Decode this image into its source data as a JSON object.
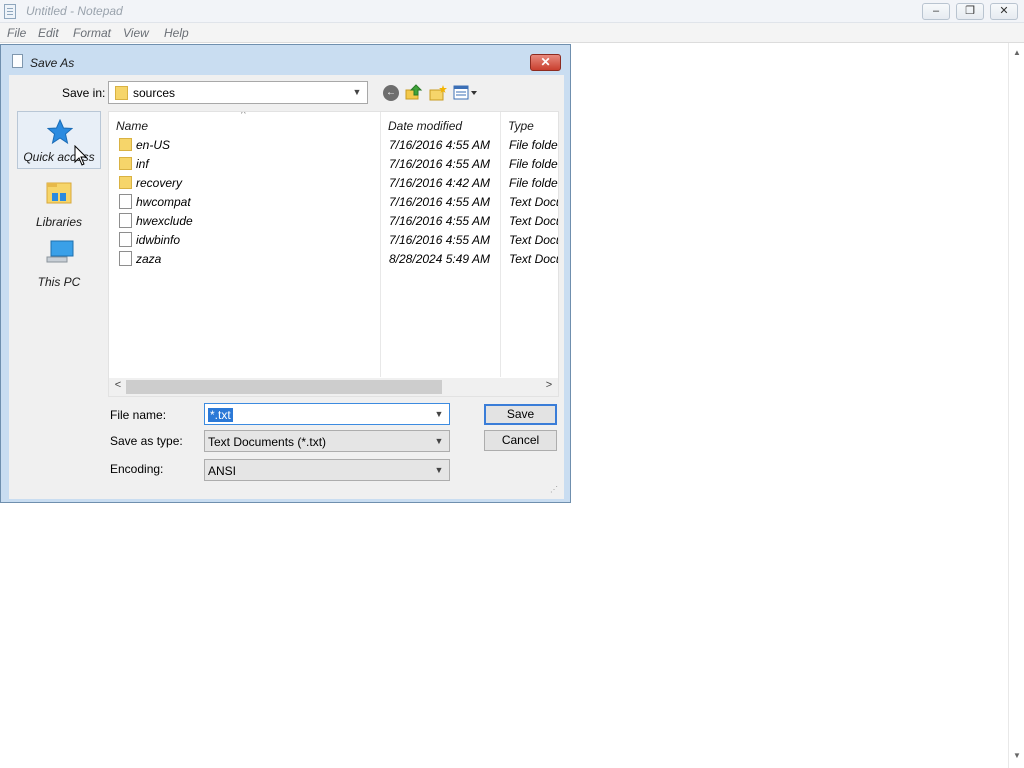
{
  "notepad": {
    "title": "Untitled - Notepad",
    "menu": [
      "File",
      "Edit",
      "Format",
      "View",
      "Help"
    ],
    "window_buttons": {
      "minimize": "–",
      "restore": "❐",
      "close": "✕"
    }
  },
  "dialog": {
    "title": "Save As",
    "close_glyph": "✕",
    "save_in_label": "Save in:",
    "save_in_value": "sources",
    "places": [
      {
        "label": "Quick access",
        "icon": "star-icon"
      },
      {
        "label": "Libraries",
        "icon": "libraries-icon"
      },
      {
        "label": "This PC",
        "icon": "computer-icon"
      }
    ],
    "columns": {
      "name": "Name",
      "date": "Date modified",
      "type": "Type"
    },
    "files": [
      {
        "name": "en-US",
        "date": "7/16/2016 4:55 AM",
        "type": "File folder",
        "kind": "folder"
      },
      {
        "name": "inf",
        "date": "7/16/2016 4:55 AM",
        "type": "File folder",
        "kind": "folder"
      },
      {
        "name": "recovery",
        "date": "7/16/2016 4:42 AM",
        "type": "File folder",
        "kind": "folder"
      },
      {
        "name": "hwcompat",
        "date": "7/16/2016 4:55 AM",
        "type": "Text Docu...",
        "kind": "file"
      },
      {
        "name": "hwexclude",
        "date": "7/16/2016 4:55 AM",
        "type": "Text Docu...",
        "kind": "file"
      },
      {
        "name": "idwbinfo",
        "date": "7/16/2016 4:55 AM",
        "type": "Text Docu...",
        "kind": "file"
      },
      {
        "name": "zaza",
        "date": "8/28/2024 5:49 AM",
        "type": "Text Docu...",
        "kind": "file"
      }
    ],
    "file_name_label": "File name:",
    "file_name_value": "*.txt",
    "save_as_type_label": "Save as type:",
    "save_as_type_value": "Text Documents (*.txt)",
    "encoding_label": "Encoding:",
    "encoding_value": "ANSI",
    "save_button": "Save",
    "cancel_button": "Cancel"
  },
  "colors": {
    "selection": "#2b79d7",
    "dialog_frame": "#c9ddf1",
    "close_red": "#c9402f"
  }
}
